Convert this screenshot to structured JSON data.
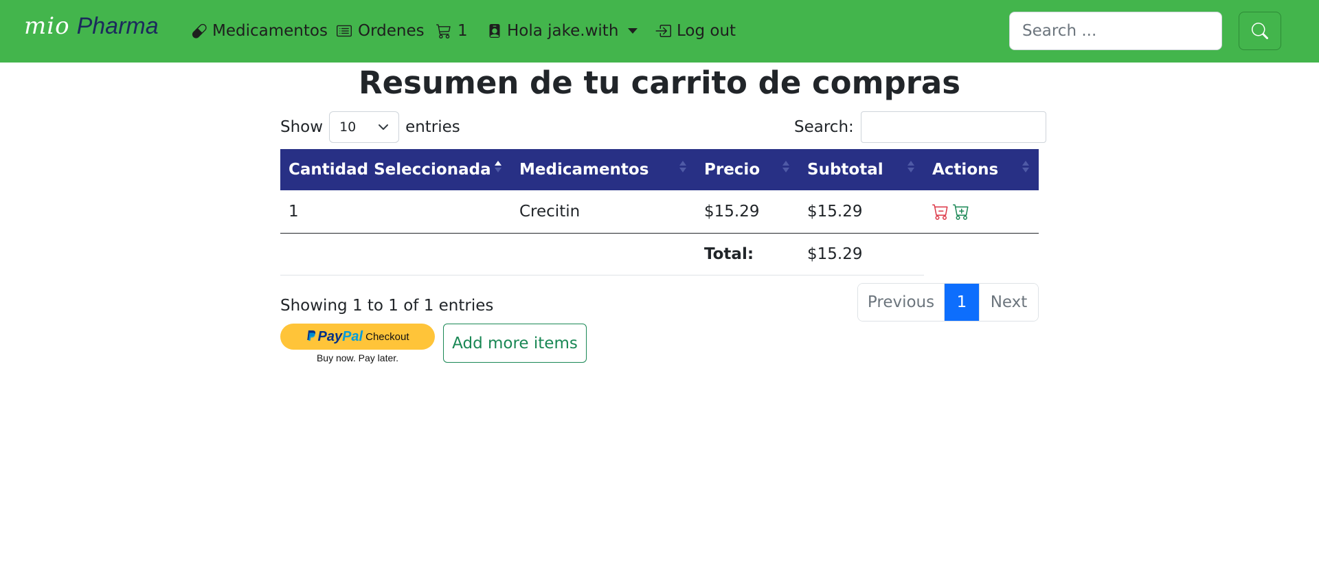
{
  "navbar": {
    "brand_mio": "mio",
    "brand_pharma": "Pharma",
    "medicamentos_label": "Medicamentos",
    "ordenes_label": "Ordenes",
    "cart_count": "1",
    "user_label": "Hola jake.with",
    "logout_label": "Log out",
    "search_placeholder": "Search ..."
  },
  "page": {
    "title": "Resumen de tu carrito de compras"
  },
  "datatable": {
    "show_label": "Show",
    "length_value": "10",
    "entries_label": "entries",
    "search_label": "Search:",
    "search_value": "",
    "columns": [
      "Cantidad Seleccionada",
      "Medicamentos",
      "Precio",
      "Subtotal",
      "Actions"
    ],
    "rows": [
      {
        "cantidad": "1",
        "medicamento": "Crecitin",
        "precio": "$15.29",
        "subtotal": "$15.29"
      }
    ],
    "total_label": "Total:",
    "total_value": "$15.29",
    "info": "Showing 1 to 1 of 1 entries",
    "pagination": {
      "previous": "Previous",
      "current": "1",
      "next": "Next"
    }
  },
  "checkout": {
    "paypal_pay": "Pay",
    "paypal_pal": "Pal",
    "paypal_checkout": "Checkout",
    "paypal_sub": "Buy now. Pay later.",
    "add_more_label": "Add more items"
  },
  "colors": {
    "navbar": "#43b54c",
    "table_header": "#283085",
    "active_page": "#0d6efd",
    "outline_success": "#198754",
    "remove_icon": "#dc3545",
    "add_icon": "#198754",
    "paypal_yellow": "#ffc439"
  },
  "icons": {
    "medicamentos": "capsule-icon",
    "ordenes": "card-list-icon",
    "cart": "cart-icon",
    "user": "person-badge-icon",
    "logout": "box-arrow-in-right-icon",
    "search": "search-icon",
    "remove": "cart-dash-icon",
    "add": "cart-plus-icon"
  }
}
